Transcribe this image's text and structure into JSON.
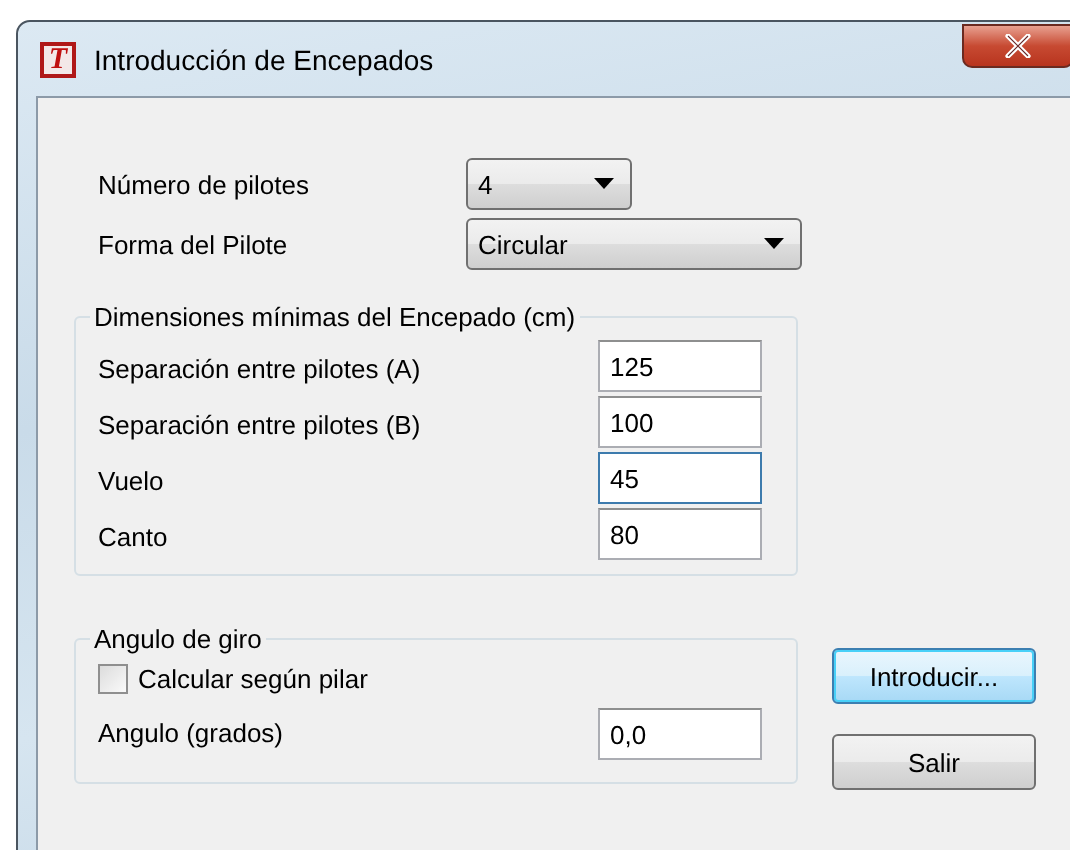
{
  "window": {
    "title": "Introducción de Encepados",
    "icon_letter": "T"
  },
  "selectors": [
    {
      "label": "Número de pilotes",
      "value": "4",
      "kind": "narrow"
    },
    {
      "label": "Forma del Pilote",
      "value": "Circular",
      "kind": "wide"
    }
  ],
  "dimensions": {
    "title": "Dimensiones mínimas del Encepado (cm)",
    "rows": [
      {
        "label": "Separación entre pilotes (A)",
        "value": "125",
        "focused": false
      },
      {
        "label": "Separación entre pilotes (B)",
        "value": "100",
        "focused": false
      },
      {
        "label": "Vuelo",
        "value": "45",
        "focused": true
      },
      {
        "label": "Canto",
        "value": "80",
        "focused": false
      }
    ]
  },
  "rotation": {
    "title": "Angulo de giro",
    "checkbox": {
      "label": "Calcular según pilar",
      "checked": false
    },
    "angle": {
      "label": "Angulo (grados)",
      "value": "0,0"
    }
  },
  "buttons": [
    {
      "label": "Introducir...",
      "default": true
    },
    {
      "label": "Salir",
      "default": false
    }
  ]
}
